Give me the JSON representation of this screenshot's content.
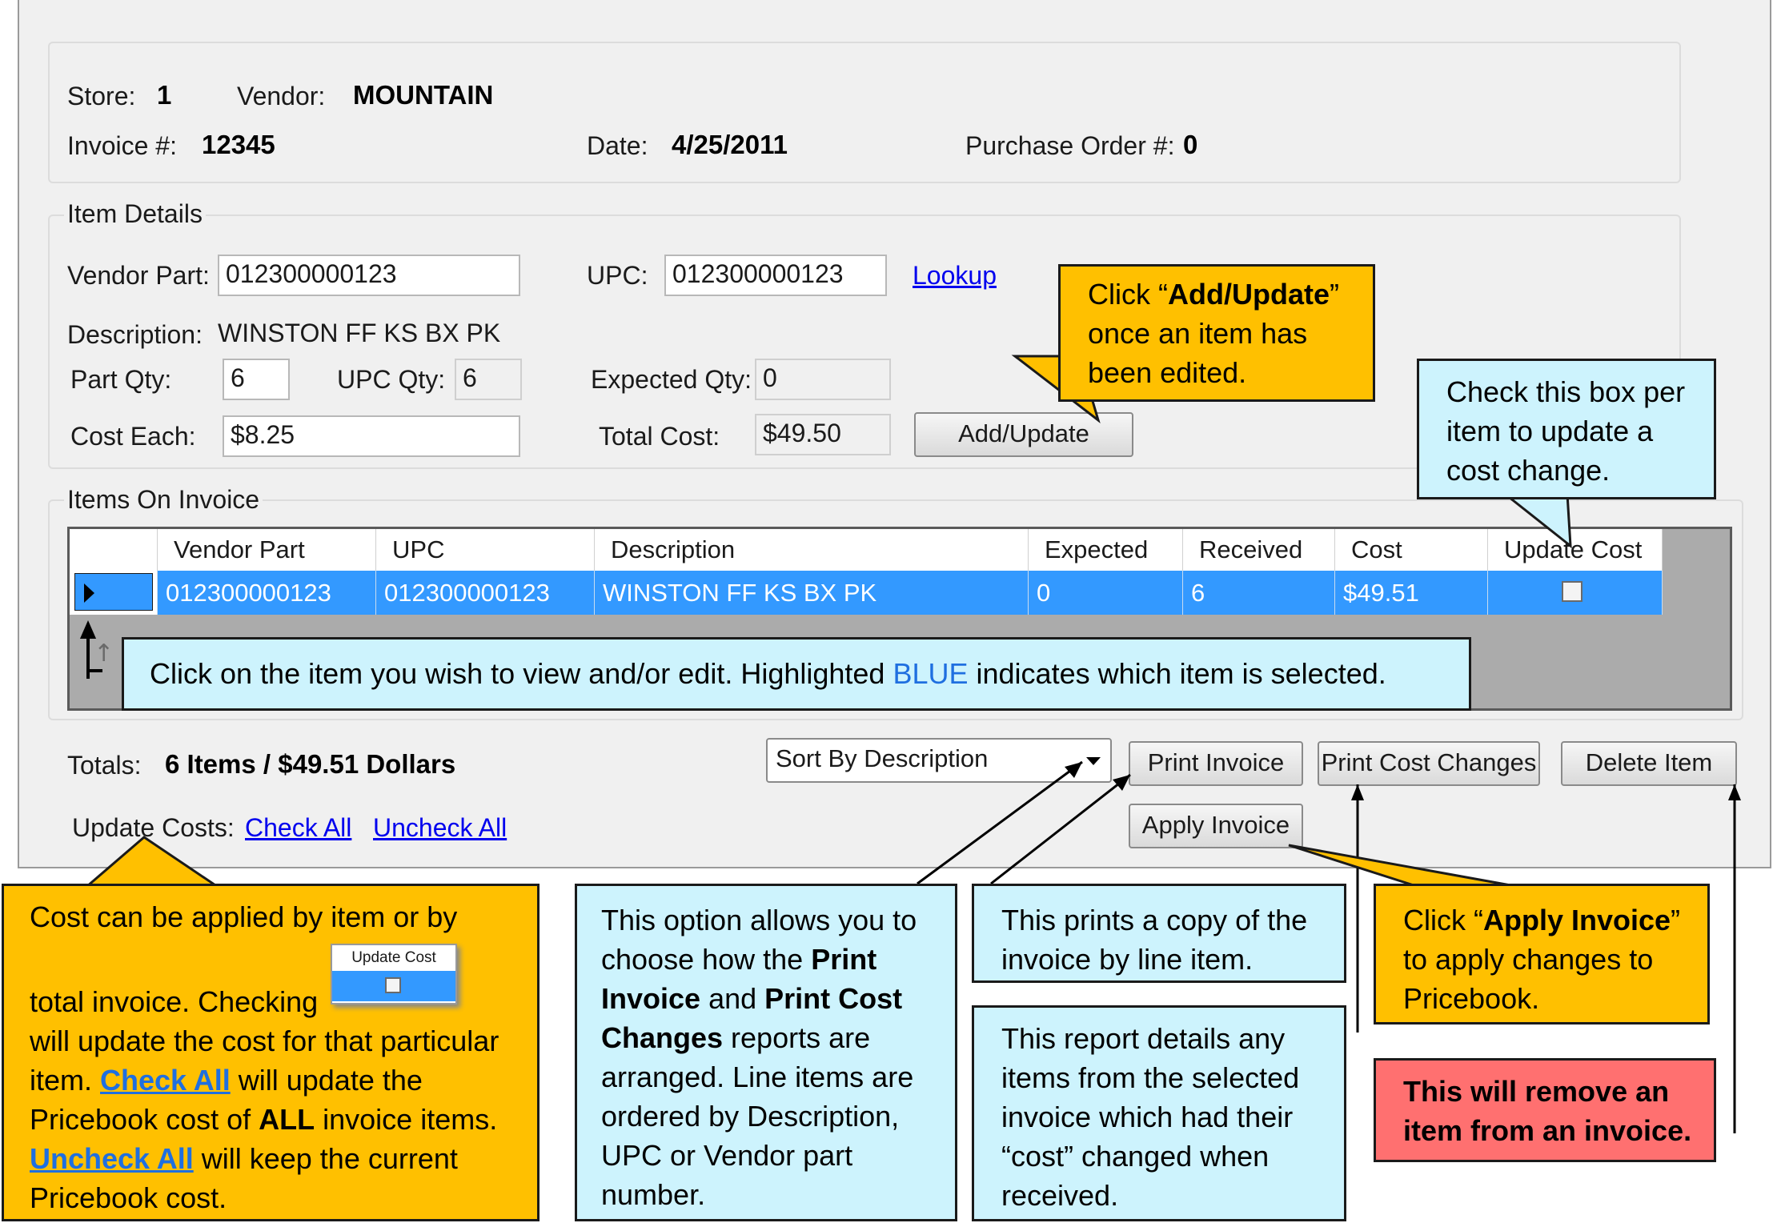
{
  "header": {
    "store_label": "Store:",
    "store_value": "1",
    "vendor_label": "Vendor:",
    "vendor_value": "MOUNTAIN",
    "invoice_label": "Invoice #:",
    "invoice_value": "12345",
    "date_label": "Date:",
    "date_value": "4/25/2011",
    "po_label": "Purchase Order #:",
    "po_value": "0"
  },
  "item_details": {
    "legend": "Item Details",
    "vendor_part_label": "Vendor Part:",
    "vendor_part_value": "012300000123",
    "upc_label": "UPC:",
    "upc_value": "012300000123",
    "lookup_link": "Lookup",
    "description_label": "Description:",
    "description_value": "WINSTON FF KS BX PK",
    "part_qty_label": "Part Qty:",
    "part_qty_value": "6",
    "upc_qty_label": "UPC Qty:",
    "upc_qty_value": "6",
    "expected_qty_label": "Expected Qty:",
    "expected_qty_value": "0",
    "cost_each_label": "Cost Each:",
    "cost_each_value": "$8.25",
    "total_cost_label": "Total Cost:",
    "total_cost_value": "$49.50",
    "add_update_button": "Add/Update"
  },
  "items_on_invoice": {
    "legend": "Items On Invoice",
    "columns": [
      "Vendor Part",
      "UPC",
      "Description",
      "Expected",
      "Received",
      "Cost",
      "Update Cost"
    ],
    "rows": [
      {
        "vendor_part": "012300000123",
        "upc": "012300000123",
        "description": "WINSTON FF KS BX PK",
        "expected": "0",
        "received": "6",
        "cost": "$49.51",
        "update_cost": false
      }
    ]
  },
  "footer": {
    "totals_label": "Totals:",
    "totals_value": "6 Items / $49.51 Dollars",
    "sort_select": "Sort By Description",
    "print_invoice_button": "Print Invoice",
    "print_cost_changes_button": "Print Cost Changes",
    "delete_item_button": "Delete Item",
    "apply_invoice_button": "Apply Invoice",
    "update_costs_label": "Update Costs:",
    "check_all_link": "Check All",
    "uncheck_all_link": "Uncheck All"
  },
  "callouts": {
    "add_update": {
      "pre": "Click “",
      "bold": "Add/Update",
      "post": "” once an item has been edited."
    },
    "check_box": "Check this box per item to update a cost change.",
    "select_item": {
      "pre": "Click on the item you wish to view and/or edit. Highlighted ",
      "blue": "BLUE",
      "post": " indicates which item is selected."
    },
    "cost_applied": {
      "line1": "Cost can be applied by item or by",
      "inset_header": "Update Cost",
      "line2": "total invoice. Checking",
      "line3": "will update the cost for that particular item. ",
      "check_all": "Check All",
      "line4": " will update the Pricebook cost of ",
      "all": "ALL",
      "line5": " invoice items. ",
      "uncheck_all": "Uncheck All",
      "line6": " will keep the current Pricebook cost."
    },
    "sort_option": {
      "t1": "This option allows you to choose how the ",
      "b1": "Print Invoice",
      "t2": " and ",
      "b2": "Print Cost Changes",
      "t3": " reports are arranged. Line items are ordered by Description, UPC or Vendor part number."
    },
    "prints_copy": "This prints a copy of the invoice by line item.",
    "report_details": "This report details any items from the selected invoice which had their “cost” changed when received.",
    "apply_invoice": {
      "pre": "Click “",
      "bold": "Apply Invoice",
      "post": "” to apply changes to Pricebook."
    },
    "remove_item": "This will remove an item from an invoice.",
    "colors": {
      "orange": "#ffc000",
      "light_blue": "#cdf3fd",
      "red": "#ff7070",
      "selection_blue": "#3399ff",
      "link_blue": "#1f6fe0"
    }
  }
}
